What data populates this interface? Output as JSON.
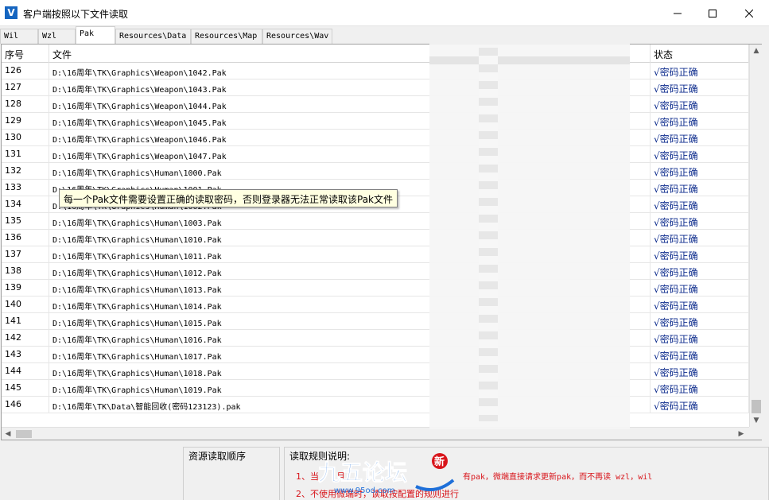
{
  "window": {
    "title": "客户端按照以下文件读取",
    "icon_letter": "V"
  },
  "tabs": [
    {
      "label": "Wil",
      "active": false
    },
    {
      "label": "Wzl",
      "active": false
    },
    {
      "label": "Pak",
      "active": true
    },
    {
      "label": "Resources\\Data",
      "active": false
    },
    {
      "label": "Resources\\Map",
      "active": false
    },
    {
      "label": "Resources\\Wav",
      "active": false
    }
  ],
  "table": {
    "columns": [
      "序号",
      "文件",
      "状态"
    ],
    "rows": [
      {
        "num": "126",
        "file": "D:\\16周年\\TK\\Graphics\\Weapon\\1042.Pak",
        "status": "√密码正确"
      },
      {
        "num": "127",
        "file": "D:\\16周年\\TK\\Graphics\\Weapon\\1043.Pak",
        "status": "√密码正确"
      },
      {
        "num": "128",
        "file": "D:\\16周年\\TK\\Graphics\\Weapon\\1044.Pak",
        "status": "√密码正确"
      },
      {
        "num": "129",
        "file": "D:\\16周年\\TK\\Graphics\\Weapon\\1045.Pak",
        "status": "√密码正确"
      },
      {
        "num": "130",
        "file": "D:\\16周年\\TK\\Graphics\\Weapon\\1046.Pak",
        "status": "√密码正确"
      },
      {
        "num": "131",
        "file": "D:\\16周年\\TK\\Graphics\\Weapon\\1047.Pak",
        "status": "√密码正确"
      },
      {
        "num": "132",
        "file": "D:\\16周年\\TK\\Graphics\\Human\\1000.Pak",
        "status": "√密码正确"
      },
      {
        "num": "133",
        "file": "D:\\16周年\\TK\\Graphics\\Human\\1001.Pak",
        "status": "√密码正确"
      },
      {
        "num": "134",
        "file": "D:\\16周年\\TK\\Graphics\\Human\\1002.Pak",
        "status": "√密码正确"
      },
      {
        "num": "135",
        "file": "D:\\16周年\\TK\\Graphics\\Human\\1003.Pak",
        "status": "√密码正确"
      },
      {
        "num": "136",
        "file": "D:\\16周年\\TK\\Graphics\\Human\\1010.Pak",
        "status": "√密码正确"
      },
      {
        "num": "137",
        "file": "D:\\16周年\\TK\\Graphics\\Human\\1011.Pak",
        "status": "√密码正确"
      },
      {
        "num": "138",
        "file": "D:\\16周年\\TK\\Graphics\\Human\\1012.Pak",
        "status": "√密码正确"
      },
      {
        "num": "139",
        "file": "D:\\16周年\\TK\\Graphics\\Human\\1013.Pak",
        "status": "√密码正确"
      },
      {
        "num": "140",
        "file": "D:\\16周年\\TK\\Graphics\\Human\\1014.Pak",
        "status": "√密码正确"
      },
      {
        "num": "141",
        "file": "D:\\16周年\\TK\\Graphics\\Human\\1015.Pak",
        "status": "√密码正确"
      },
      {
        "num": "142",
        "file": "D:\\16周年\\TK\\Graphics\\Human\\1016.Pak",
        "status": "√密码正确"
      },
      {
        "num": "143",
        "file": "D:\\16周年\\TK\\Graphics\\Human\\1017.Pak",
        "status": "√密码正确"
      },
      {
        "num": "144",
        "file": "D:\\16周年\\TK\\Graphics\\Human\\1018.Pak",
        "status": "√密码正确"
      },
      {
        "num": "145",
        "file": "D:\\16周年\\TK\\Graphics\\Human\\1019.Pak",
        "status": "√密码正确"
      },
      {
        "num": "146",
        "file": "D:\\16周年\\TK\\Data\\智能回收(密码123123).pak",
        "status": "√密码正确"
      }
    ]
  },
  "tooltip": "每一个Pak文件需要设置正确的读取密码，否则登录器无法正常读取该Pak文件",
  "bottom": {
    "order_title": "资源读取顺序",
    "rules_title": "读取规则说明:",
    "rules": [
      {
        "prefix": "1、当",
        "mid": "月",
        "suffix": "有pak，微端直接请求更新pak，而不再读 wzl，wil"
      },
      {
        "text": "2、不使用微端时，读取按配置的规则进行"
      }
    ]
  },
  "watermark": {
    "text": "九五论坛",
    "badge": "新",
    "url": "www.95od.com"
  },
  "colors": {
    "status_text": "#0b2a8c",
    "rules_text": "#d8141a",
    "tooltip_bg": "#ffffe1",
    "app_icon_bg": "#1565c0",
    "watermark_blue": "#1e6fd9"
  },
  "icons": {
    "minimize": "minimize-icon",
    "maximize": "maximize-icon",
    "close": "close-icon"
  }
}
